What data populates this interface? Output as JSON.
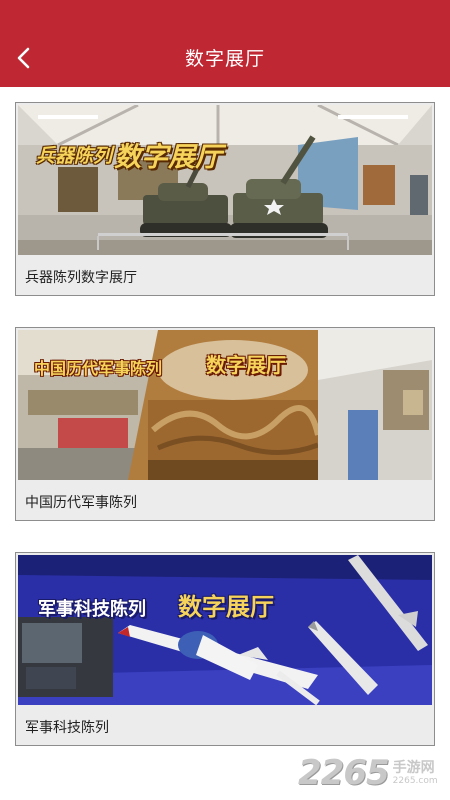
{
  "header": {
    "title": "数字展厅",
    "back_icon": "chevron-left-icon",
    "background_color": "#bf2732"
  },
  "cards": [
    {
      "caption": "兵器陈列数字展厅",
      "overlay_prefix": "兵器陈列",
      "overlay_suffix": "数字展厅"
    },
    {
      "caption": "中国历代军事陈列",
      "overlay_prefix": "中国历代军事陈列",
      "overlay_suffix": "数字展厅"
    },
    {
      "caption": "军事科技陈列",
      "overlay_prefix": "军事科技陈列",
      "overlay_suffix": "数字展厅"
    }
  ],
  "watermark": {
    "number": "2265",
    "chinese": "手游网",
    "domain": "2265.com"
  }
}
